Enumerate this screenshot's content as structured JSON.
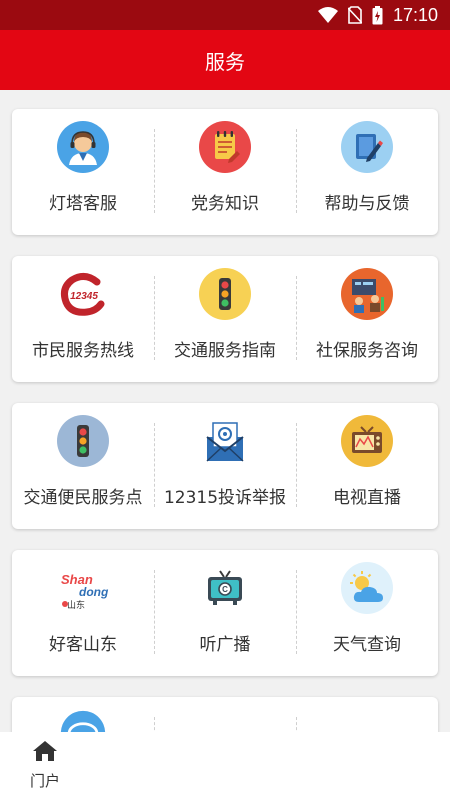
{
  "status_bar": {
    "time": "17:10"
  },
  "header": {
    "title": "服务"
  },
  "cards": [
    {
      "tiles": [
        {
          "label": "灯塔客服",
          "icon": "customer-service-icon"
        },
        {
          "label": "党务知识",
          "icon": "notebook-icon"
        },
        {
          "label": "帮助与反馈",
          "icon": "edit-document-icon"
        }
      ]
    },
    {
      "tiles": [
        {
          "label": "市民服务热线",
          "icon": "hotline-12345-icon"
        },
        {
          "label": "交通服务指南",
          "icon": "traffic-light-icon"
        },
        {
          "label": "社保服务咨询",
          "icon": "social-security-icon"
        }
      ]
    },
    {
      "tiles": [
        {
          "label": "交通便民服务点",
          "icon": "traffic-light-icon"
        },
        {
          "label": "12315投诉举报",
          "icon": "envelope-icon"
        },
        {
          "label": "电视直播",
          "icon": "tv-icon"
        }
      ]
    },
    {
      "tiles": [
        {
          "label": "好客山东",
          "icon": "shandong-logo-icon"
        },
        {
          "label": "听广播",
          "icon": "radio-icon"
        },
        {
          "label": "天气查询",
          "icon": "weather-icon"
        }
      ]
    }
  ],
  "hotline_icon_text": "12345",
  "shandong_logo_text": "Shan dong 山东",
  "bottom_nav": {
    "home_label": "门户",
    "home_icon": "home-icon"
  },
  "colors": {
    "header": "#e30613",
    "status_bar": "#9b0a10",
    "background": "#f1f1f1"
  }
}
